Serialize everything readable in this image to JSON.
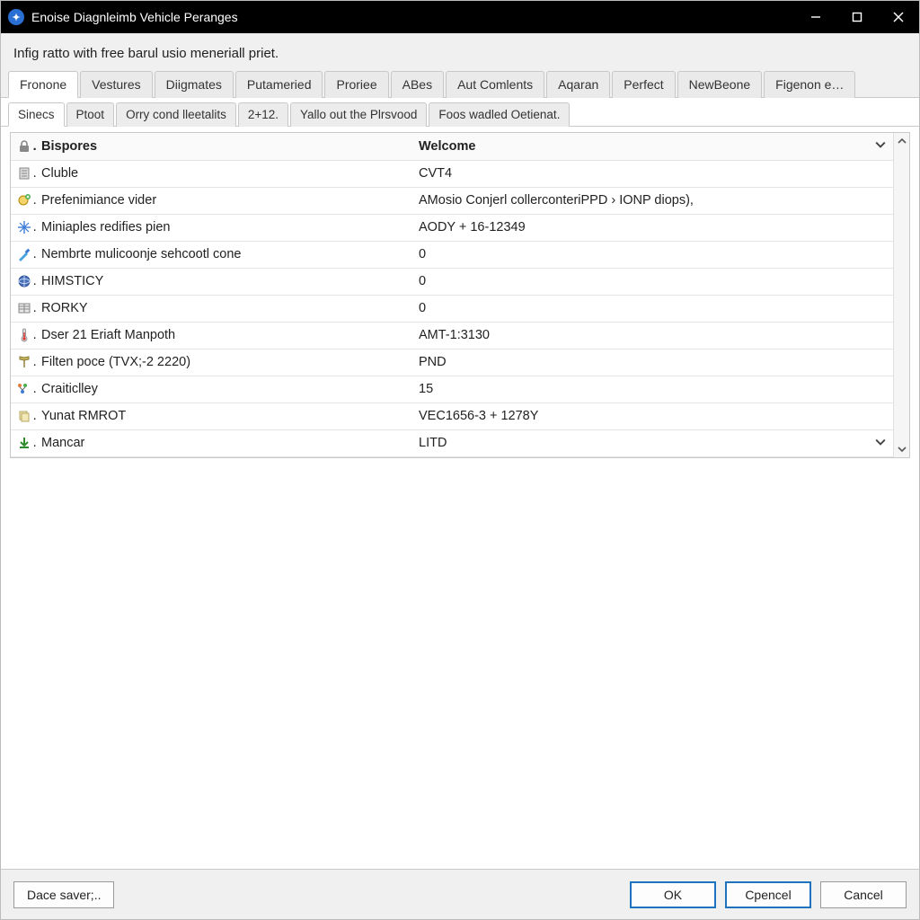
{
  "window": {
    "title": "Enoise Diagnleimb Vehicle Peranges"
  },
  "description": "Infig ratto with free barul usio meneriall priet.",
  "tabs_primary": [
    "Fronone",
    "Vestures",
    "Diigmates",
    "Putameried",
    "Proriee",
    "ABes",
    "Aut Comlents",
    "Aqaran",
    "Perfect",
    "NewBeone",
    "Figenon e…"
  ],
  "tabs_primary_active": 0,
  "tabs_secondary": [
    "Sinecs",
    "Ptoot",
    "Orry cond lleetalits",
    "2+12.",
    "Yallo out the Plrsvood",
    "Foos wadled Oetienat."
  ],
  "tabs_secondary_active": 0,
  "properties": {
    "header": {
      "name": "Bispores",
      "value": "Welcome"
    },
    "rows": [
      {
        "icon": "doc-icon",
        "name": "Cluble",
        "value": "CVT4",
        "dropdown": false
      },
      {
        "icon": "globe-plus-icon",
        "name": "Prefenimiance vider",
        "value": "AMosio Conjerl collerconteriPPD › IONP diops),",
        "dropdown": false
      },
      {
        "icon": "star-cross-icon",
        "name": "Miniaples redifies pien",
        "value": "AODY + 16-12349",
        "dropdown": false
      },
      {
        "icon": "brush-icon",
        "name": "Nembrte mulicoonje sehcootl cone",
        "value": "0",
        "dropdown": false
      },
      {
        "icon": "globe-icon",
        "name": "HIMSTICY",
        "value": "0",
        "dropdown": false
      },
      {
        "icon": "table-icon",
        "name": "RORKY",
        "value": "0",
        "dropdown": false
      },
      {
        "icon": "thermometer-icon",
        "name": "Dser 21 Eriaft Manpoth",
        "value": "AMT-1:3130",
        "dropdown": false
      },
      {
        "icon": "filter-icon",
        "name": "Filten poce (TVX;-2 2220)",
        "value": "PND",
        "dropdown": false
      },
      {
        "icon": "tree-icon",
        "name": "Craiticlley",
        "value": "15",
        "dropdown": false
      },
      {
        "icon": "stack-icon",
        "name": "Yunat RMROT",
        "value": "VEC1656-3 + 1278Y",
        "dropdown": false
      },
      {
        "icon": "download-icon",
        "name": "Mancar",
        "value": "LITD",
        "dropdown": true
      }
    ]
  },
  "buttons": {
    "save": "Dace saver;..",
    "ok": "OK",
    "cpencel": "Cpencel",
    "cancel": "Cancel"
  },
  "colors": {
    "accent": "#1e73be"
  }
}
